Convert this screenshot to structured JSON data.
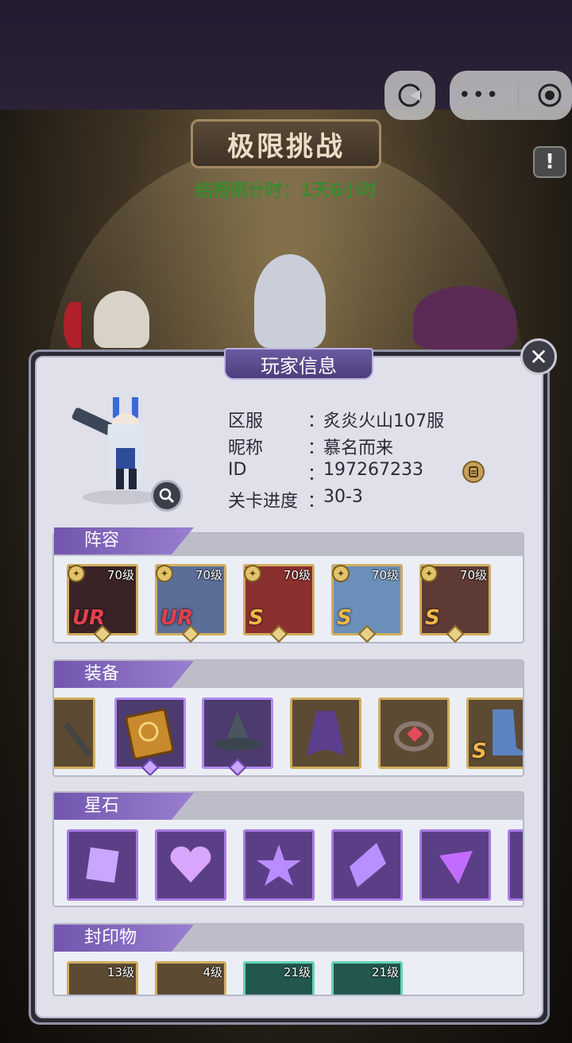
{
  "header": {
    "title": "极限挑战",
    "countdown": "结榜倒计时：1天6小时",
    "alert_symbol": "!"
  },
  "dialog": {
    "title": "玩家信息",
    "close_symbol": "✕"
  },
  "player": {
    "rows": [
      {
        "key": "区服",
        "value": "炙炎火山107服"
      },
      {
        "key": "昵称",
        "value": "慕名而来"
      },
      {
        "key": "ID",
        "value": "197267233"
      },
      {
        "key": "关卡进度",
        "value": "30-3"
      }
    ],
    "colon": "："
  },
  "lineup": {
    "label": "阵容",
    "heroes": [
      {
        "level": "70级",
        "rank": "UR",
        "rank_color": "#e0414c",
        "class_icon": "sword-icon"
      },
      {
        "level": "70级",
        "rank": "UR",
        "rank_color": "#e0414c",
        "class_icon": "staff-icon"
      },
      {
        "level": "70级",
        "rank": "S",
        "rank_color": "#f0b84a",
        "class_icon": "wand-icon"
      },
      {
        "level": "70级",
        "rank": "S",
        "rank_color": "#f0b84a",
        "class_icon": "sword-icon"
      },
      {
        "level": "70级",
        "rank": "S",
        "rank_color": "#f0b84a",
        "class_icon": "spiral-icon"
      }
    ]
  },
  "equipment": {
    "label": "装备",
    "items": [
      {
        "name": "staff-item-icon",
        "frame": "gold"
      },
      {
        "name": "spellbook-item-icon",
        "frame": "purple"
      },
      {
        "name": "wizard-hat-item-icon",
        "frame": "purple"
      },
      {
        "name": "cloak-item-icon",
        "frame": "gold"
      },
      {
        "name": "ring-item-icon",
        "frame": "gold"
      },
      {
        "name": "boots-item-icon",
        "frame": "gold",
        "rank": "S"
      }
    ]
  },
  "star_stones": {
    "label": "星石",
    "items": [
      "square-gem-icon",
      "heart-gem-icon",
      "star-gem-icon",
      "diamond-gem-icon",
      "triangle-gem-icon"
    ]
  },
  "seals": {
    "label": "封印物",
    "items": [
      {
        "level": "13级",
        "frame": "gold"
      },
      {
        "level": "4级",
        "frame": "gold"
      },
      {
        "level": "21级",
        "frame": "green"
      },
      {
        "level": "21级",
        "frame": "green"
      }
    ]
  },
  "colors": {
    "accent_purple": "#7256ae",
    "countdown_green": "#3b8a2f",
    "panel_bg": "#dfe0ea"
  }
}
